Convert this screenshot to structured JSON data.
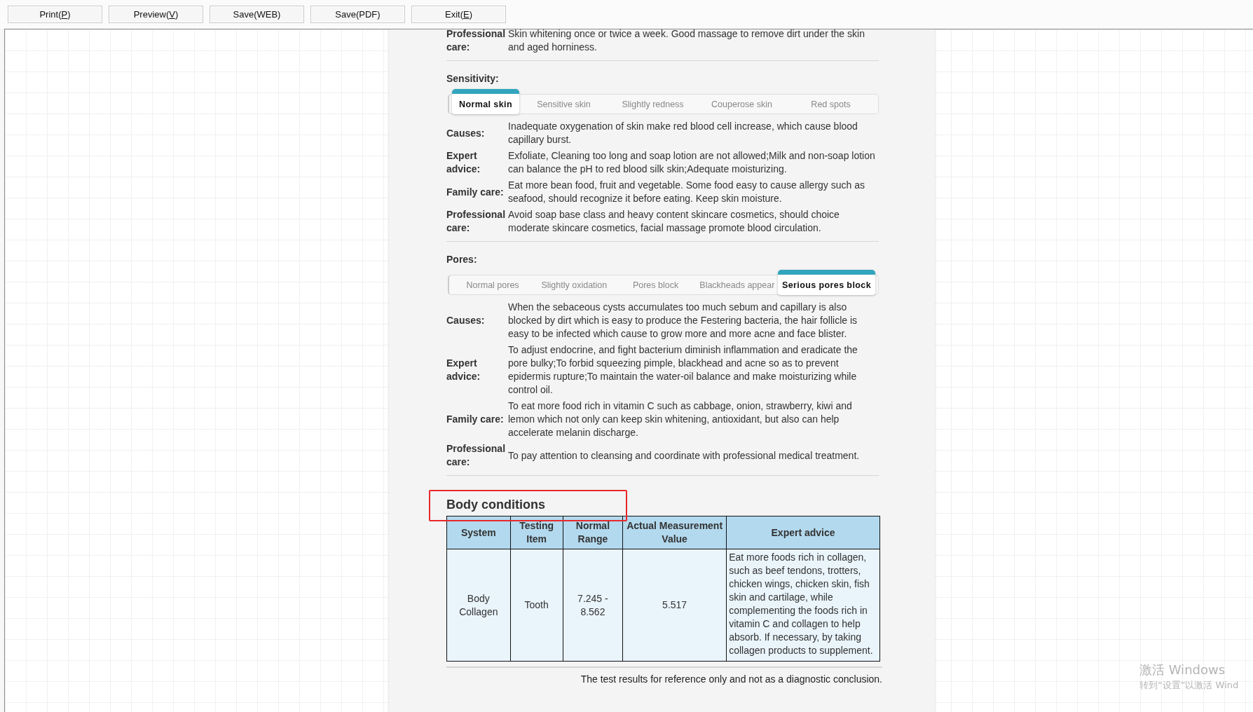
{
  "toolbar": {
    "buttons": [
      {
        "before": "Print(",
        "key": "P",
        "after": ")"
      },
      {
        "before": "Preview(",
        "key": "V",
        "after": ")"
      },
      {
        "before": "Save(WEB)"
      },
      {
        "before": "Save(PDF)"
      },
      {
        "before": "Exit(",
        "key": "E",
        "after": ")"
      }
    ]
  },
  "sections": [
    {
      "rows": [
        {
          "label": "Professional care:",
          "text": "Skin whitening once or twice a week. Good massage to remove dirt under the skin and aged horniness."
        }
      ]
    },
    {
      "title": "Sensitivity:",
      "tabs": [
        {
          "label": "Normal skin",
          "selected": true
        },
        {
          "label": "Sensitive skin",
          "selected": false
        },
        {
          "label": "Slightly redness",
          "selected": false
        },
        {
          "label": "Couperose skin",
          "selected": false
        },
        {
          "label": "Red spots",
          "selected": false
        }
      ],
      "rows": [
        {
          "label": "Causes:",
          "text": "Inadequate oxygenation of skin make red blood cell increase, which cause blood capillary burst."
        },
        {
          "label": "Expert advice:",
          "text": "Exfoliate, Cleaning too long and soap lotion are not allowed;Milk and non-soap lotion can balance the pH to red blood silk skin;Adequate moisturizing."
        },
        {
          "label": "Family care:",
          "text": "Eat more bean food, fruit and vegetable. Some food easy to cause allergy such as seafood, should recognize it before eating. Keep skin moisture."
        },
        {
          "label": "Professional care:",
          "text": "Avoid soap base class and heavy content skincare cosmetics, should choice moderate skincare cosmetics, facial massage promote blood circulation."
        }
      ]
    },
    {
      "title": "Pores:",
      "tabs": [
        {
          "label": "Normal pores",
          "selected": false
        },
        {
          "label": "Slightly oxidation",
          "selected": false
        },
        {
          "label": "Pores block",
          "selected": false
        },
        {
          "label": "Blackheads appear",
          "selected": false
        },
        {
          "label": "Serious pores block",
          "selected": true
        }
      ],
      "rows": [
        {
          "label": "Causes:",
          "text": "When the sebaceous cysts accumulates too much sebum and capillary is also blocked by dirt which is easy to produce the Festering bacteria, the hair follicle is easy to be infected which cause to grow more and more acne and face blister."
        },
        {
          "label": "Expert advice:",
          "text": "To adjust endocrine, and fight bacterium diminish inflammation and eradicate the pore bulky;To forbid squeezing pimple, blackhead and acne so as to prevent epidermis rupture;To maintain the water-oil balance and make moisturizing while control oil."
        },
        {
          "label": "Family care:",
          "text": "To eat more food rich in vitamin C such as cabbage, onion, strawberry, kiwi and lemon which not only can keep skin whitening, antioxidant, but also can help accelerate melanin discharge."
        },
        {
          "label": "Professional care:",
          "text": "To pay attention to cleansing and coordinate with professional medical treatment."
        }
      ]
    }
  ],
  "body_conditions": {
    "title": "Body conditions",
    "columns": [
      "System",
      "Testing Item",
      "Normal Range",
      "Actual Measurement Value",
      "Expert advice"
    ],
    "rows": [
      [
        "Body Collagen",
        "Tooth",
        "7.245 - 8.562",
        "5.517",
        "Eat more foods rich in collagen, such as beef tendons, trotters, chicken wings, chicken skin, fish skin and cartilage, while complementing the foods rich in vitamin C and collagen to help absorb. If necessary, by taking collagen products to supplement."
      ]
    ]
  },
  "footer_note": "The test results for reference only and not as a diagnostic conclusion.",
  "activation_notice": {
    "title": "激活 Windows",
    "hint": "转到“设置”以激活 Wind"
  }
}
